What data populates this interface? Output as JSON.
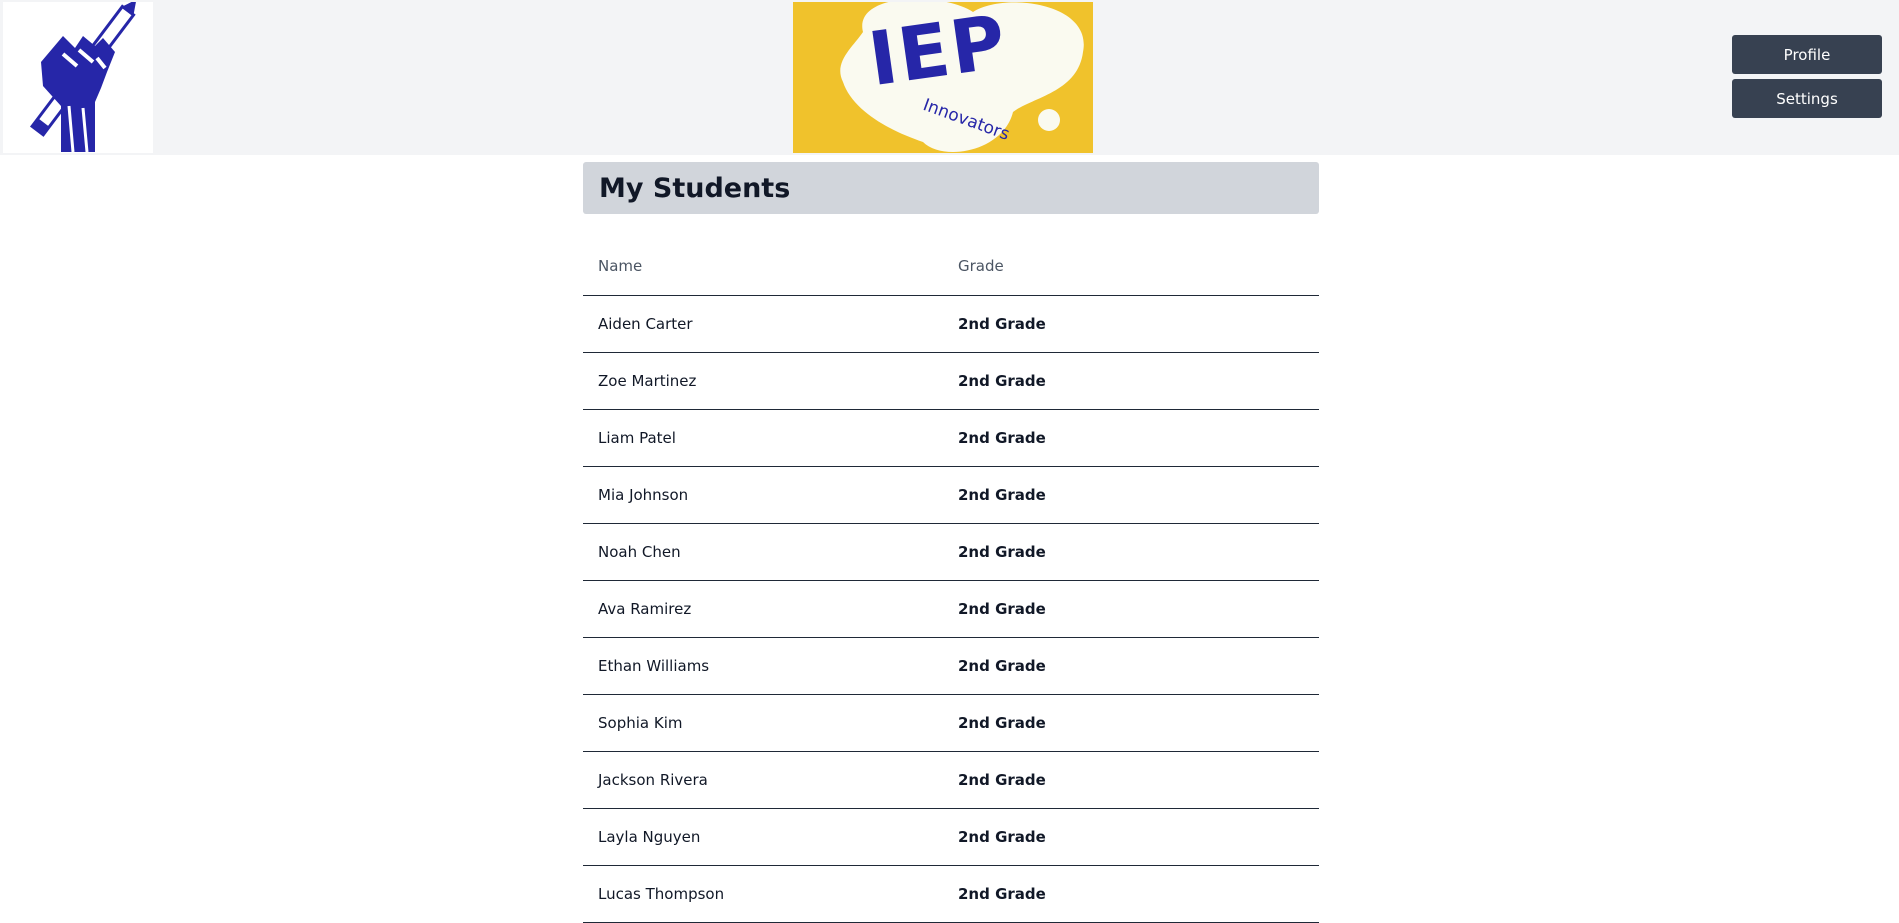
{
  "header": {
    "logo_left_icon": "raised-fist-pencil-icon",
    "logo_center_text": "IEP",
    "logo_center_subtext": "Innovators",
    "buttons": {
      "profile": "Profile",
      "settings": "Settings"
    },
    "colors": {
      "logo_blue": "#2626a8",
      "logo_yellow": "#f0c22c",
      "logo_cream": "#fafaf0",
      "button_bg": "#374151"
    }
  },
  "main": {
    "title": "My Students",
    "table": {
      "columns": [
        "Name",
        "Grade"
      ],
      "rows": [
        {
          "name": "Aiden Carter",
          "grade": "2nd Grade"
        },
        {
          "name": "Zoe Martinez",
          "grade": "2nd Grade"
        },
        {
          "name": "Liam Patel",
          "grade": "2nd Grade"
        },
        {
          "name": "Mia Johnson",
          "grade": "2nd Grade"
        },
        {
          "name": "Noah Chen",
          "grade": "2nd Grade"
        },
        {
          "name": "Ava Ramirez",
          "grade": "2nd Grade"
        },
        {
          "name": "Ethan Williams",
          "grade": "2nd Grade"
        },
        {
          "name": "Sophia Kim",
          "grade": "2nd Grade"
        },
        {
          "name": "Jackson Rivera",
          "grade": "2nd Grade"
        },
        {
          "name": "Layla Nguyen",
          "grade": "2nd Grade"
        },
        {
          "name": "Lucas Thompson",
          "grade": "2nd Grade"
        }
      ]
    }
  }
}
